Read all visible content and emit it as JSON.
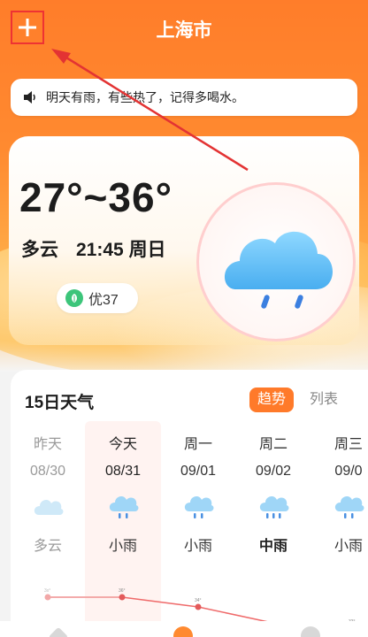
{
  "header": {
    "city": "上海市"
  },
  "notice": {
    "text": "明天有雨，有些热了，记得多喝水。"
  },
  "current": {
    "temp_range": "27°~36°",
    "condition": "多云",
    "time": "21:45",
    "weekday": "周日",
    "aqi_label": "优37"
  },
  "forecast": {
    "title": "15日天气",
    "tab_trend": "趋势",
    "tab_list": "列表",
    "days": [
      {
        "name": "昨天",
        "date": "08/30",
        "cond": "多云",
        "icon": "cloudy-icon"
      },
      {
        "name": "今天",
        "date": "08/31",
        "cond": "小雨",
        "icon": "light-rain-icon"
      },
      {
        "name": "周一",
        "date": "09/01",
        "cond": "小雨",
        "icon": "light-rain-icon"
      },
      {
        "name": "周二",
        "date": "09/02",
        "cond": "中雨",
        "icon": "moderate-rain-icon"
      },
      {
        "name": "周三",
        "date": "09/0",
        "cond": "小雨",
        "icon": "light-rain-icon"
      }
    ],
    "trend_labels": [
      "3x°",
      "36°",
      "34°",
      "33°"
    ]
  },
  "colors": {
    "accent": "#ff7a2a",
    "annotation": "#e33333"
  }
}
